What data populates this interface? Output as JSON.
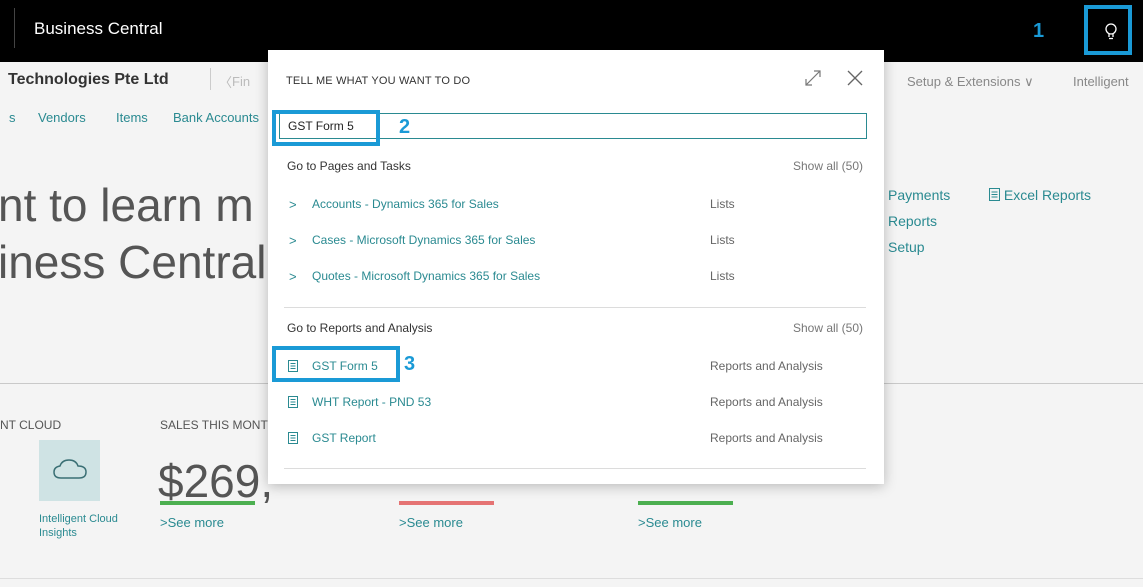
{
  "app": {
    "title": "Business Central"
  },
  "header": {
    "company": "Technologies Pte Ltd",
    "fin_fragment": "Fin",
    "setup_menu": "Setup & Extensions",
    "intelligent_menu": "Intelligent"
  },
  "nav": {
    "links": [
      "s",
      "Vendors",
      "Items",
      "Bank Accounts"
    ]
  },
  "hero": {
    "line1": "nt to learn m",
    "line2": "iness Central"
  },
  "actions": {
    "payments": "Payments",
    "reports": "Reports",
    "setup": "Setup",
    "excel_reports": "Excel Reports"
  },
  "cues": {
    "cloud_title": "NT CLOUD",
    "sales_title": "SALES THIS MONT",
    "cloud_label_line1": "Intelligent Cloud",
    "cloud_label_line2": "Insights",
    "sales_value": "$269,",
    "see_more": "See more",
    "bar_colors": [
      "#4caf50",
      "#e57373",
      "#4caf50"
    ]
  },
  "annotations": {
    "step1": "1",
    "step2": "2",
    "step3": "3",
    "color": "#1a9ad6"
  },
  "tell_me": {
    "title": "TELL ME WHAT YOU WANT TO DO",
    "search_value": "GST Form 5",
    "sections": [
      {
        "heading": "Go to Pages and Tasks",
        "show_all": "Show all (50)",
        "items": [
          {
            "name": "Accounts - Dynamics 365 for Sales",
            "category": "Lists",
            "icon": "chevron-right-icon"
          },
          {
            "name": "Cases - Microsoft Dynamics 365 for Sales",
            "category": "Lists",
            "icon": "chevron-right-icon"
          },
          {
            "name": "Quotes - Microsoft Dynamics 365 for Sales",
            "category": "Lists",
            "icon": "chevron-right-icon"
          }
        ]
      },
      {
        "heading": "Go to Reports and Analysis",
        "show_all": "Show all (50)",
        "items": [
          {
            "name": "GST Form 5",
            "category": "Reports and Analysis",
            "icon": "report-icon"
          },
          {
            "name": "WHT Report - PND 53",
            "category": "Reports and Analysis",
            "icon": "report-icon"
          },
          {
            "name": "GST Report",
            "category": "Reports and Analysis",
            "icon": "report-icon"
          }
        ]
      }
    ]
  }
}
